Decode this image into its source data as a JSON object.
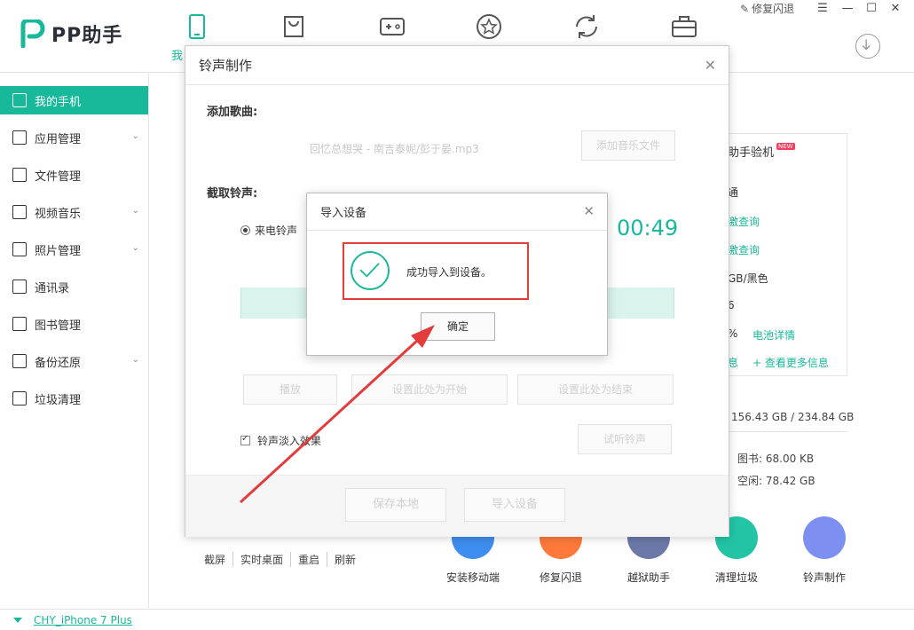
{
  "app": {
    "brand": "PP助手",
    "nav_partial_label": "我",
    "repair_link": "修复闪退"
  },
  "sidebar": {
    "items": [
      {
        "label": "我的手机",
        "active": true
      },
      {
        "label": "应用管理",
        "expand": true
      },
      {
        "label": "文件管理",
        "expand": false
      },
      {
        "label": "视频音乐",
        "expand": true
      },
      {
        "label": "照片管理",
        "expand": true
      },
      {
        "label": "通讯录",
        "expand": false
      },
      {
        "label": "图书管理",
        "expand": false
      },
      {
        "label": "备份还原",
        "expand": true
      },
      {
        "label": "垃圾清理",
        "expand": false
      }
    ]
  },
  "device": {
    "name": "CHY_iPhone 7 Plus"
  },
  "info": {
    "title": "助手验机",
    "badge": "NEW",
    "line1": "通",
    "line2": "激查询",
    "line3": "激查询",
    "line4": "GB/黑色",
    "line5": "6",
    "battery_prefix": "%",
    "battery_link": "电池详情",
    "more_prefix": "息",
    "more_link": "+ 查看更多信息",
    "storage_total": "156.43 GB / 234.84 GB",
    "books": "图书: 68.00 KB",
    "free": "空闲: 78.42 GB"
  },
  "quick_actions": [
    {
      "label": "安装移动端",
      "color": "#3d8ef0"
    },
    {
      "label": "修复闪退",
      "color": "#ff7a3a"
    },
    {
      "label": "越狱助手",
      "color": "#6c79a8"
    },
    {
      "label": "清理垃圾",
      "color": "#23c4a6"
    },
    {
      "label": "铃声制作",
      "color": "#7e8ff2"
    }
  ],
  "controls": [
    "截屏",
    "实时桌面",
    "重启",
    "刷新"
  ],
  "ringtone": {
    "title": "铃声制作",
    "add_song_label": "添加歌曲:",
    "song_file": "回忆总想哭 - 南吉泰妮/彭于晏.mp3",
    "add_file_button": "添加音乐文件",
    "cut_label": "截取铃声:",
    "radio_label": "来电铃声",
    "time": "00:49",
    "play_button": "播放",
    "set_start_button": "设置此处为开始",
    "set_end_button": "设置此处为结束",
    "fade_label": "铃声淡入效果",
    "listen_button": "试听铃声",
    "save_button": "保存本地",
    "import_button": "导入设备"
  },
  "import_dialog": {
    "title": "导入设备",
    "message": "成功导入到设备。",
    "ok_button": "确定"
  },
  "colors": {
    "accent": "#18b89a",
    "highlight": "#e33c3c"
  }
}
